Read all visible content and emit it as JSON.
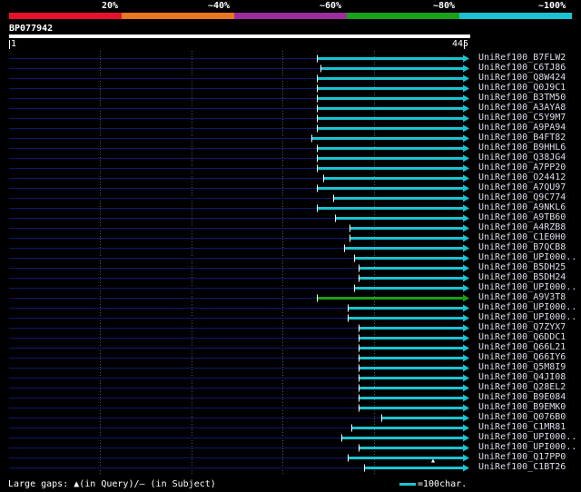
{
  "scale_labels": [
    "20%",
    "~40%",
    "~60%",
    "~80%",
    "~100%"
  ],
  "scale_colors": [
    "#e8112d",
    "#e87722",
    "#9b2e9b",
    "#1aa01a",
    "#19c4d2"
  ],
  "query": {
    "id": "BP077942",
    "start": "1",
    "end": "445"
  },
  "colors": {
    "hit": "#19c4d2",
    "hit_highlight": "#1aa01a",
    "guide": "#0d1a6b",
    "gridline": "#555555"
  },
  "hits": [
    {
      "name": "UniRef100_B7FLW2",
      "start": 0.676
    },
    {
      "name": "UniRef100_C6TJ86",
      "start": 0.683
    },
    {
      "name": "UniRef100_Q8W424",
      "start": 0.676
    },
    {
      "name": "UniRef100_Q0J9C1",
      "start": 0.676
    },
    {
      "name": "UniRef100_B3TM50",
      "start": 0.676
    },
    {
      "name": "UniRef100_A3AYA8",
      "start": 0.676
    },
    {
      "name": "UniRef100_C5Y9M7",
      "start": 0.676
    },
    {
      "name": "UniRef100_A9PA94",
      "start": 0.676
    },
    {
      "name": "UniRef100_B4FT82",
      "start": 0.663
    },
    {
      "name": "UniRef100_B9HHL6",
      "start": 0.676
    },
    {
      "name": "UniRef100_Q38JG4",
      "start": 0.676
    },
    {
      "name": "UniRef100_A7PP20",
      "start": 0.676
    },
    {
      "name": "UniRef100_O24412",
      "start": 0.69
    },
    {
      "name": "UniRef100_A7QU97",
      "start": 0.676
    },
    {
      "name": "UniRef100_Q9C774",
      "start": 0.711
    },
    {
      "name": "UniRef100_A9NKL6",
      "start": 0.676
    },
    {
      "name": "UniRef100_A9TB60",
      "start": 0.715
    },
    {
      "name": "UniRef100_A4RZB8",
      "start": 0.748
    },
    {
      "name": "UniRef100_C1E0H0",
      "start": 0.748
    },
    {
      "name": "UniRef100_B7QCB8",
      "start": 0.735
    },
    {
      "name": "UniRef100_UPI000..",
      "start": 0.756
    },
    {
      "name": "UniRef100_B5DH25",
      "start": 0.766
    },
    {
      "name": "UniRef100_B5DH24",
      "start": 0.766
    },
    {
      "name": "UniRef100_UPI000..",
      "start": 0.756
    },
    {
      "name": "UniRef100_A9V3T8",
      "start": 0.676,
      "highlight": true
    },
    {
      "name": "UniRef100_UPI000..",
      "start": 0.744
    },
    {
      "name": "UniRef100_UPI000..",
      "start": 0.744
    },
    {
      "name": "UniRef100_Q7ZYX7",
      "start": 0.766
    },
    {
      "name": "UniRef100_Q6DDC1",
      "start": 0.766
    },
    {
      "name": "UniRef100_Q66L21",
      "start": 0.766
    },
    {
      "name": "UniRef100_Q66IY6",
      "start": 0.766
    },
    {
      "name": "UniRef100_Q5M8I9",
      "start": 0.766
    },
    {
      "name": "UniRef100_Q4JI08",
      "start": 0.766
    },
    {
      "name": "UniRef100_Q28EL2",
      "start": 0.766
    },
    {
      "name": "UniRef100_B9E084",
      "start": 0.766
    },
    {
      "name": "UniRef100_B9EMK0",
      "start": 0.766
    },
    {
      "name": "UniRef100_Q076B0",
      "start": 0.817
    },
    {
      "name": "UniRef100_C1MR81",
      "start": 0.75
    },
    {
      "name": "UniRef100_UPI000..",
      "start": 0.73
    },
    {
      "name": "UniRef100_UPI000..",
      "start": 0.766
    },
    {
      "name": "UniRef100_Q17PP0",
      "start": 0.744,
      "query_gap": true
    },
    {
      "name": "UniRef100_C1BT26",
      "start": 0.778
    }
  ],
  "legend": {
    "text": "Large gaps: ▲(in Query)/– (in Subject)",
    "scale_text": "=100char."
  }
}
